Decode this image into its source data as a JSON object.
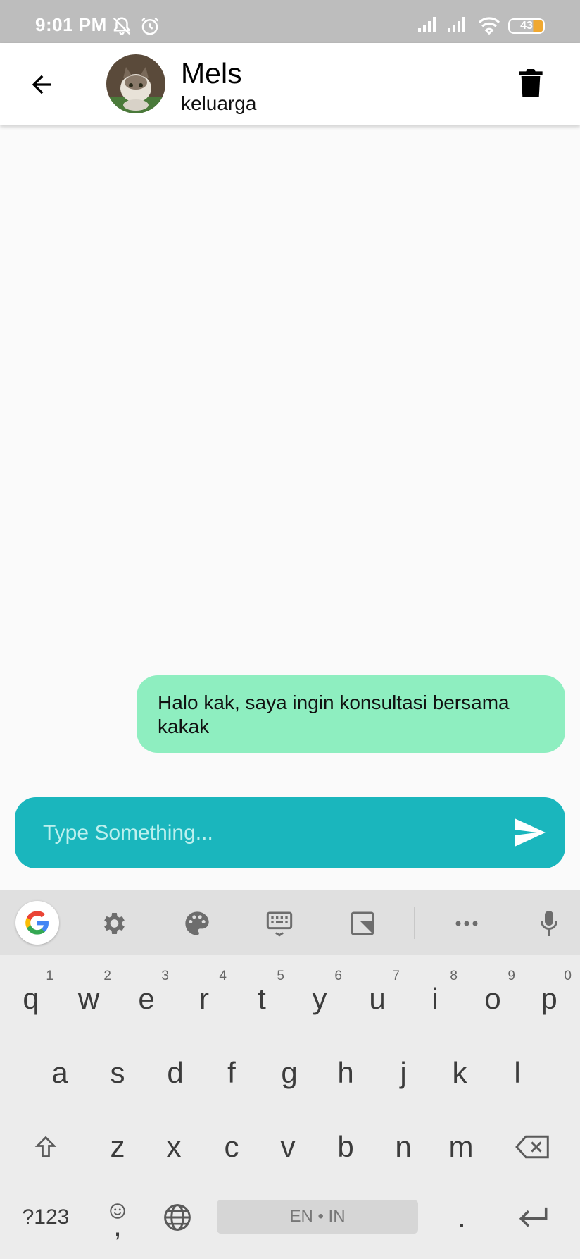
{
  "status_bar": {
    "time": "9:01 PM",
    "battery": "43"
  },
  "header": {
    "contact_name": "Mels",
    "contact_subtitle": "keluarga"
  },
  "messages": [
    {
      "text": "Halo kak, saya ingin konsultasi bersama kakak",
      "direction": "outgoing"
    }
  ],
  "composer": {
    "placeholder": "Type Something..."
  },
  "keyboard": {
    "row1": [
      {
        "key": "q",
        "hint": "1"
      },
      {
        "key": "w",
        "hint": "2"
      },
      {
        "key": "e",
        "hint": "3"
      },
      {
        "key": "r",
        "hint": "4"
      },
      {
        "key": "t",
        "hint": "5"
      },
      {
        "key": "y",
        "hint": "6"
      },
      {
        "key": "u",
        "hint": "7"
      },
      {
        "key": "i",
        "hint": "8"
      },
      {
        "key": "o",
        "hint": "9"
      },
      {
        "key": "p",
        "hint": "0"
      }
    ],
    "row2": [
      "a",
      "s",
      "d",
      "f",
      "g",
      "h",
      "j",
      "k",
      "l"
    ],
    "row3": [
      "z",
      "x",
      "c",
      "v",
      "b",
      "n",
      "m"
    ],
    "symbols_label": "?123",
    "comma": ",",
    "space_label": "EN • IN",
    "period": "."
  },
  "colors": {
    "bubble": "#8eeec0",
    "composer": "#1ab6bd",
    "status_bar": "#bdbdbd"
  }
}
